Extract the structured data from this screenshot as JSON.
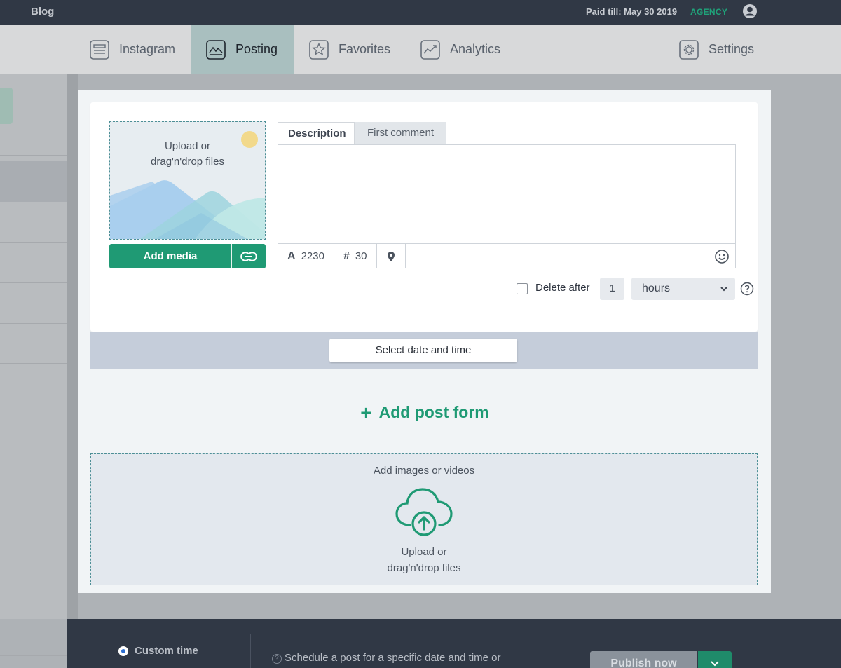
{
  "topbar": {
    "brand": "Blog",
    "paid_till": "Paid till: May 30 2019",
    "plan": "AGENCY"
  },
  "nav": {
    "items": [
      {
        "label": "Instagram",
        "icon": "list-icon"
      },
      {
        "label": "Posting",
        "icon": "image-icon",
        "active": true
      },
      {
        "label": "Favorites",
        "icon": "star-icon"
      },
      {
        "label": "Analytics",
        "icon": "chart-icon"
      },
      {
        "label": "Settings",
        "icon": "gear-icon"
      }
    ]
  },
  "post_form": {
    "media_drop_text_1": "Upload or",
    "media_drop_text_2": "drag'n'drop files",
    "add_media_label": "Add media",
    "tabs": {
      "description": "Description",
      "first_comment": "First comment"
    },
    "description_value": "",
    "char_count": "2230",
    "hashtag_count": "30",
    "delete_after_label": "Delete after",
    "delete_after_value": "1",
    "delete_after_unit": "hours",
    "select_date_label": "Select date and time"
  },
  "add_post_form_label": "Add post form",
  "bulk_drop": {
    "title": "Add images or videos",
    "text_1": "Upload or",
    "text_2": "drag'n'drop files"
  },
  "bottom": {
    "custom_time_label": "Custom time",
    "schedule_hint": "Schedule a post for a specific date and time or",
    "publish_label": "Publish now"
  },
  "colors": {
    "accent": "#1f9a74",
    "topbar": "#303845",
    "active_tab": "#a9bfbf",
    "date_bar": "#c5cdda"
  }
}
